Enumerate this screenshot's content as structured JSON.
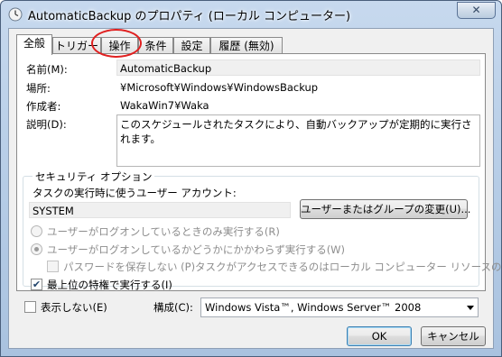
{
  "window": {
    "title": "AutomaticBackup のプロパティ (ローカル コンピューター)",
    "close_label": "✕"
  },
  "tabs": [
    "全般",
    "トリガー",
    "操作",
    "条件",
    "設定",
    "履歴 (無効)"
  ],
  "active_tab": "全般",
  "highlighted_tab": "操作",
  "general": {
    "name_label": "名前(M):",
    "name_value": "AutomaticBackup",
    "location_label": "場所:",
    "location_value": "¥Microsoft¥Windows¥WindowsBackup",
    "author_label": "作成者:",
    "author_value": "WakaWin7¥Waka",
    "description_label": "説明(D):",
    "description_value": "このスケジュールされたタスクにより、自動バックアップが定期的に実行されます。"
  },
  "security": {
    "group_title": "セキュリティ オプション",
    "run_as_label": "タスクの実行時に使うユーザー アカウント:",
    "account_value": "SYSTEM",
    "change_user_button": "ユーザーまたはグループの変更(U)...",
    "radio_logged_on": "ユーザーがログオンしているときのみ実行する(R)",
    "radio_whether": "ユーザーがログオンしているかどうかにかかわらず実行する(W)",
    "no_store_password": "パスワードを保存しない (P)タスクがアクセスできるのはローカル コンピューター リソースのみ",
    "highest_privileges": "最上位の特権で実行する(I)",
    "highest_privileges_checked": true
  },
  "footer": {
    "hidden_label": "表示しない(E)",
    "config_label": "構成(C):",
    "config_value": "Windows Vista™, Windows Server™ 2008"
  },
  "buttons": {
    "ok": "OK",
    "cancel": "キャンセル"
  },
  "colors": {
    "annotation": "#e02020",
    "titlebar": "#b9cfe8"
  }
}
